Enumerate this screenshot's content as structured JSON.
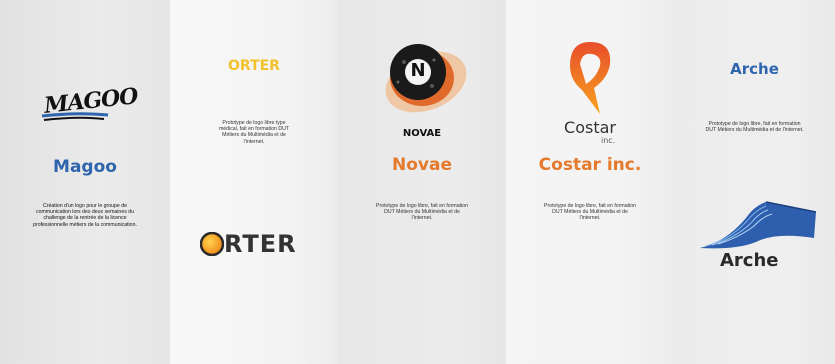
{
  "cards": {
    "magoo": {
      "logo_text": "MAGOO",
      "title": "Magoo",
      "description": "Création d'un logo pour le groupe de communication lors des deux semaines du challenge de la rentrée de la licence professionnelle métiers de la communication."
    },
    "orter": {
      "title": "ORTER",
      "description": "Prototype de logo libre type médical, fait en formation DUT Métiers du Multimédia et de l'internet.",
      "logo_text": "RTER"
    },
    "novae": {
      "logo_letter": "N",
      "logo_text": "NOVAE",
      "title": "Novae",
      "description": "Prototype de logo libre, fait en formation DUT Métiers du Multimédia et de l'internet."
    },
    "costar": {
      "logo_text": "Costar",
      "logo_subtext": "inc.",
      "title": "Costar inc.",
      "description": "Prototype de logo libre, fait en formation DUT Métiers du Multimédia et de l'internet."
    },
    "arche": {
      "title": "Arche",
      "description": "Prototype de logo libre, fait en formation DUT Métiers du Multimédia et de l'internet.",
      "logo_text": "Arche"
    }
  },
  "colors": {
    "blue": "#2e65ad",
    "orange": "#e5792c",
    "yellow": "#f1c22b"
  }
}
